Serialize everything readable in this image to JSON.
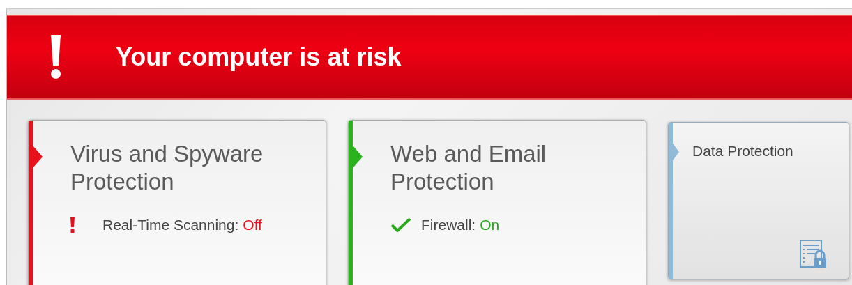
{
  "banner": {
    "title": "Your computer is at risk"
  },
  "cards": [
    {
      "kind": "large",
      "color": "#e8101a",
      "title": "Virus and Spyware Protection",
      "items": [
        {
          "label": "Real-Time Scanning:",
          "value": "Off",
          "on": false
        }
      ]
    },
    {
      "kind": "large",
      "color": "#2db21f",
      "title": "Web and Email Protection",
      "items": [
        {
          "label": "Firewall:",
          "value": "On",
          "on": true
        }
      ]
    },
    {
      "kind": "small",
      "color": "#8fbad8",
      "title": "Data Protection"
    }
  ]
}
